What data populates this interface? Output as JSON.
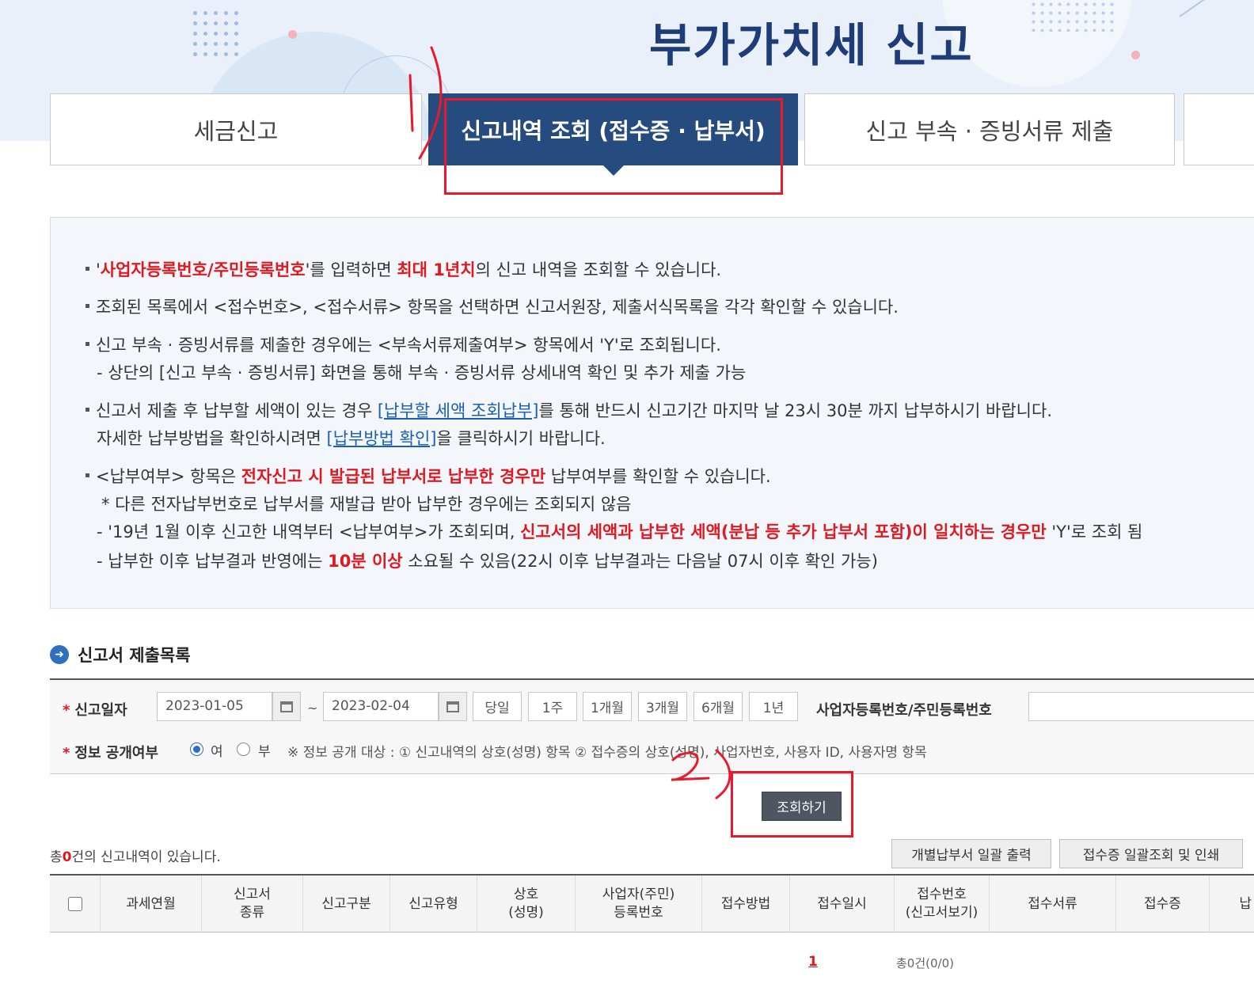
{
  "header": {
    "title": "부가가치세 신고"
  },
  "tabs": [
    {
      "label": "세금신고"
    },
    {
      "label": "신고내역 조회 (접수증 · 납부서)"
    },
    {
      "label": "신고 부속 · 증빙서류 제출"
    }
  ],
  "annotations": {
    "mark1": "1)",
    "mark2": "2)"
  },
  "info": {
    "l1": {
      "q1": "'",
      "red1": "사업자등록번호/주민등록번호",
      "t1": "'를 입력하면 ",
      "red2": "최대 1년치",
      "t2": "의 신고 내역을 조회할 수 있습니다."
    },
    "l2": "조회된 목록에서 <접수번호>, <접수서류> 항목을 선택하면 신고서원장, 제출서식목록을 각각 확인할 수 있습니다.",
    "l3": "신고 부속 · 증빙서류를 제출한 경우에는 <부속서류제출여부> 항목에서 'Y'로 조회됩니다.",
    "l3sub": "- 상단의 [신고 부속 · 증빙서류] 화면을 통해 부속 · 증빙서류 상세내역 확인 및 추가 제출 가능",
    "l4": {
      "t1": "신고서 제출 후 납부할 세액이 있는 경우 ",
      "link1": "[납부할 세액 조회납부]",
      "t2": "를 통해 반드시 신고기간 마지막 날 23시 30분 까지 납부하시기 바랍니다."
    },
    "l4sub": {
      "t1": "자세한 납부방법을 확인하시려면 ",
      "link": "[납부방법 확인]",
      "t2": "을 클릭하시기 바랍니다."
    },
    "l5": {
      "t1": "<납부여부> 항목은 ",
      "red": "전자신고 시 발급된 납부서로 납부한 경우만",
      "t2": " 납부여부를 확인할 수 있습니다."
    },
    "l5a": "* 다른 전자납부번호로 납부서를 재발급 받아 납부한 경우에는 조회되지 않음",
    "l5b": {
      "t1": "- '19년 1월 이후 신고한 내역부터 <납부여부>가 조회되며, ",
      "red": "신고서의 세액과 납부한 세액(분납 등 추가 납부서 포함)이 일치하는 경우만",
      "t2": " 'Y'로 조회 됨"
    },
    "l5c": {
      "t1": "- 납부한 이후 납부결과 반영에는 ",
      "red": "10분 이상",
      "t2": " 소요될 수 있음(22시 이후 납부결과는 다음날 07시 이후 확인 가능)"
    }
  },
  "section": {
    "title": "신고서 제출목록"
  },
  "form": {
    "date_label": "신고일자",
    "date_from": "2023-01-05",
    "date_sep": "~",
    "date_to": "2023-02-04",
    "periods": [
      "당일",
      "1주",
      "1개월",
      "3개월",
      "6개월",
      "1년"
    ],
    "biz_label": "사업자등록번호/주민등록번호",
    "biz_value": "",
    "disclose_label": "정보 공개여부",
    "disclose_yes": "여",
    "disclose_no": "부",
    "disclose_selected": "여",
    "notice": "※ 정보 공개 대상 : ① 신고내역의 상호(성명) 항목 ② 접수증의 상호(성명), 사업자번호, 사용자 ID, 사용자명 항목"
  },
  "actions": {
    "search": "조회하기",
    "count_prefix": "총",
    "count_num": "0",
    "count_suffix": "건의 신고내역이 있습니다.",
    "bulk_print": "개별납부서 일괄 출력",
    "receipt_print": "접수증 일괄조회 및 인쇄"
  },
  "table": {
    "headers": [
      "과세연월",
      "신고서\n종류",
      "신고구분",
      "신고유형",
      "상호\n(성명)",
      "사업자(주민)\n등록번호",
      "접수방법",
      "접수일시",
      "접수번호\n(신고서보기)",
      "접수서류",
      "접수증",
      "납"
    ]
  },
  "pager": {
    "page": "1",
    "total": "총0건(0/0)"
  }
}
